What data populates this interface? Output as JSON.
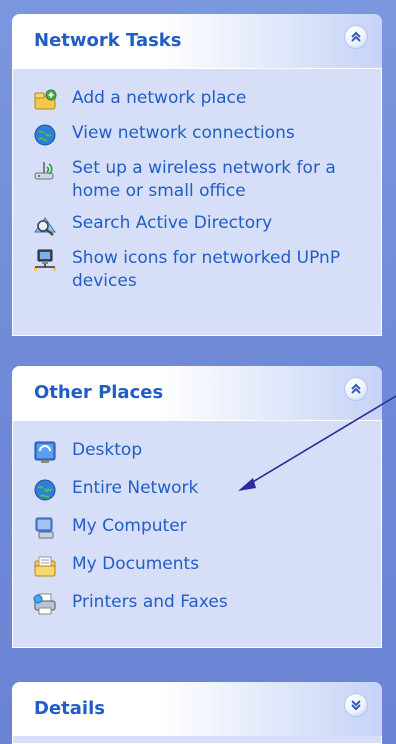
{
  "network_tasks": {
    "title": "Network Tasks",
    "items": [
      {
        "label": "Add a network place",
        "icon": "add-network-place-icon"
      },
      {
        "label": "View network connections",
        "icon": "network-connections-icon"
      },
      {
        "label": "Set up a wireless network for a home or small office",
        "icon": "wireless-network-icon"
      },
      {
        "label": "Search Active Directory",
        "icon": "search-directory-icon"
      },
      {
        "label": "Show icons for networked UPnP devices",
        "icon": "upnp-devices-icon"
      }
    ]
  },
  "other_places": {
    "title": "Other Places",
    "items": [
      {
        "label": "Desktop",
        "icon": "desktop-icon"
      },
      {
        "label": "Entire Network",
        "icon": "globe-icon"
      },
      {
        "label": "My Computer",
        "icon": "my-computer-icon"
      },
      {
        "label": "My Documents",
        "icon": "my-documents-icon"
      },
      {
        "label": "Printers and Faxes",
        "icon": "printer-icon"
      }
    ]
  },
  "details": {
    "title": "Details"
  },
  "colors": {
    "link": "#215dc6",
    "panel_bg": "#d6dff7",
    "background": "#6f8ad8",
    "annotation_arrow": "#2a2a9a"
  }
}
